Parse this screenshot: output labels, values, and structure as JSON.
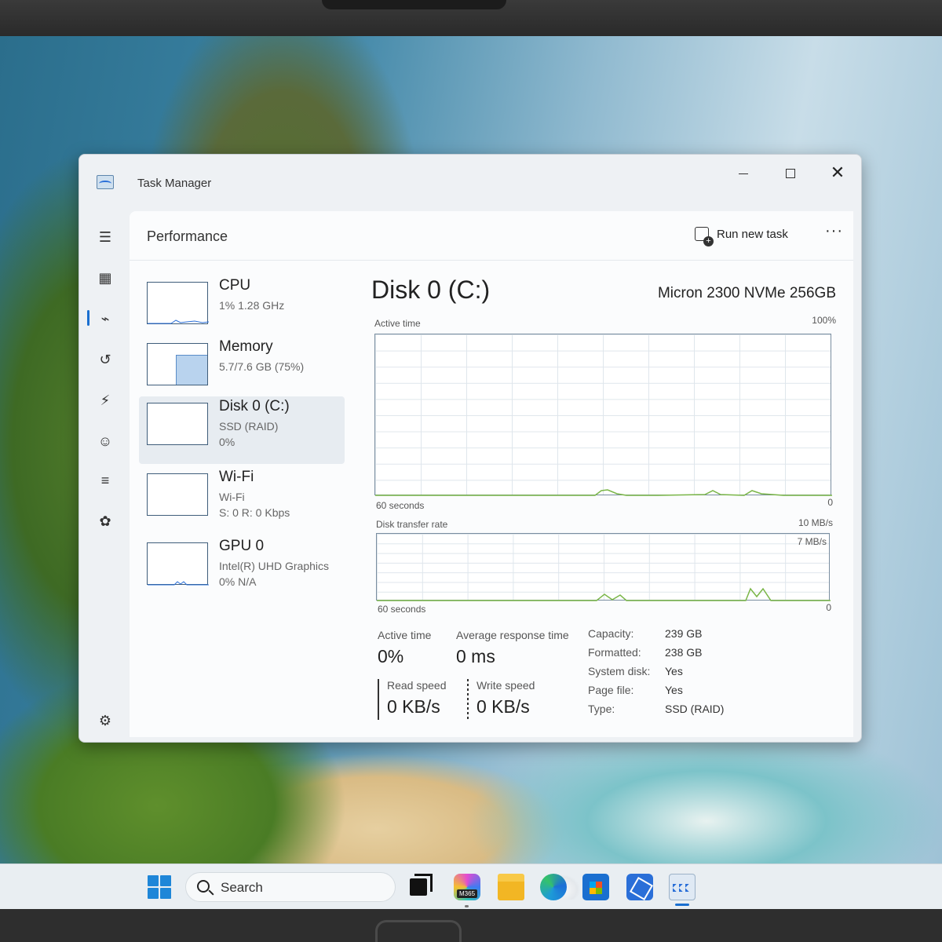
{
  "window": {
    "title": "Task Manager"
  },
  "header": {
    "page_title": "Performance",
    "run_new_task": "Run new task",
    "more": "···"
  },
  "resources": [
    {
      "name": "CPU",
      "line1": "1%  1.28 GHz",
      "line2": ""
    },
    {
      "name": "Memory",
      "line1": "5.7/7.6 GB (75%)",
      "line2": ""
    },
    {
      "name": "Disk 0 (C:)",
      "line1": "SSD (RAID)",
      "line2": "0%"
    },
    {
      "name": "Wi-Fi",
      "line1": "Wi-Fi",
      "line2": "S: 0  R: 0 Kbps"
    },
    {
      "name": "GPU 0",
      "line1": "Intel(R) UHD Graphics",
      "line2": "0%  N/A"
    }
  ],
  "detail": {
    "title": "Disk 0 (C:)",
    "model": "Micron 2300 NVMe 256GB",
    "graph1": {
      "label": "Active time",
      "max": "100%",
      "xlabel": "60 seconds",
      "min": "0"
    },
    "graph2": {
      "label": "Disk transfer rate",
      "max": "10 MB/s",
      "mid": "7 MB/s",
      "xlabel": "60 seconds",
      "min": "0"
    },
    "stats": {
      "active_time_label": "Active time",
      "active_time_value": "0%",
      "avg_resp_label": "Average response time",
      "avg_resp_value": "0 ms",
      "read_label": "Read speed",
      "read_value": "0 KB/s",
      "write_label": "Write speed",
      "write_value": "0 KB/s"
    },
    "info": [
      {
        "k": "Capacity:",
        "v": "239 GB"
      },
      {
        "k": "Formatted:",
        "v": "238 GB"
      },
      {
        "k": "System disk:",
        "v": "Yes"
      },
      {
        "k": "Page file:",
        "v": "Yes"
      },
      {
        "k": "Type:",
        "v": "SSD (RAID)"
      }
    ]
  },
  "taskbar": {
    "search_label": "Search",
    "copilot_badge": "M365"
  }
}
